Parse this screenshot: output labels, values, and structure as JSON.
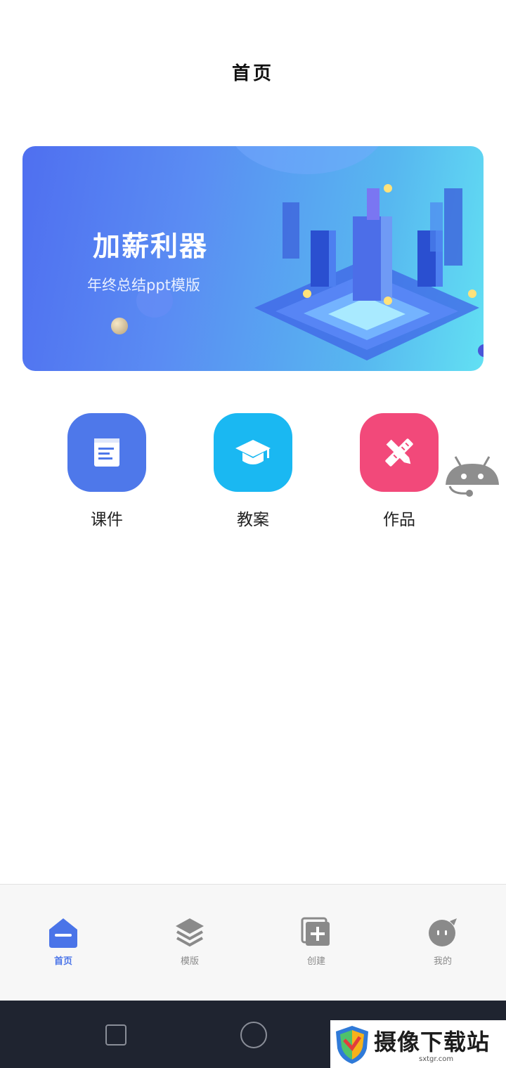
{
  "page_title": "首页",
  "banner": {
    "headline": "加薪利器",
    "subline": "年终总结ppt模版"
  },
  "shortcuts": [
    {
      "label": "课件",
      "color": "#4e78ea",
      "icon": "document-icon"
    },
    {
      "label": "教案",
      "color": "#1ab8f2",
      "icon": "graduation-cap-icon"
    },
    {
      "label": "作品",
      "color": "#f2497a",
      "icon": "pencil-ruler-icon"
    }
  ],
  "tabs": [
    {
      "label": "首页",
      "icon": "home-icon",
      "active": true
    },
    {
      "label": "模版",
      "icon": "layers-icon",
      "active": false
    },
    {
      "label": "创建",
      "icon": "add-square-icon",
      "active": false
    },
    {
      "label": "我的",
      "icon": "profile-face-icon",
      "active": false
    }
  ],
  "watermark": {
    "text": "摄像下载站",
    "url": "sxtgr.com"
  },
  "colors": {
    "accent": "#4a74e8",
    "inactive": "#8a8a8a"
  }
}
